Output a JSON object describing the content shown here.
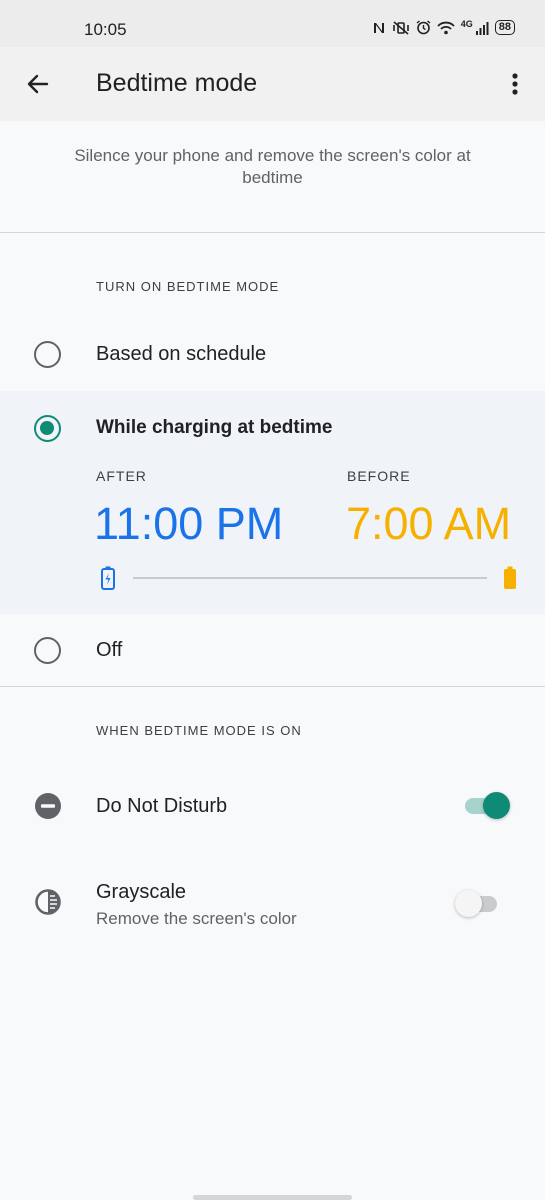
{
  "status_bar": {
    "time": "10:05",
    "battery": "88",
    "network": "4G"
  },
  "app_bar": {
    "title": "Bedtime mode"
  },
  "description": "Silence your phone and remove the screen's color at bedtime",
  "turn_on_section": {
    "header": "TURN ON BEDTIME MODE",
    "options": [
      {
        "label": "Based on schedule",
        "selected": false
      },
      {
        "label": "While charging at bedtime",
        "selected": true
      },
      {
        "label": "Off",
        "selected": false
      }
    ],
    "charging": {
      "after_label": "AFTER",
      "after_time": "11:00 PM",
      "before_label": "BEFORE",
      "before_time": "7:00 AM"
    }
  },
  "when_on_section": {
    "header": "WHEN BEDTIME MODE IS ON",
    "items": [
      {
        "title": "Do Not Disturb",
        "enabled": true
      },
      {
        "title": "Grayscale",
        "subtitle": "Remove the screen's color",
        "enabled": false
      }
    ]
  },
  "colors": {
    "accent": "#0f8a75",
    "after_time": "#1a73e8",
    "before_time": "#f6b100"
  }
}
